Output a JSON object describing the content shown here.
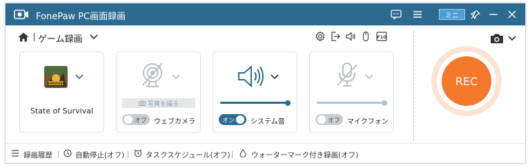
{
  "app": {
    "title": "FonePaw PC画面録画",
    "mini_label": "ミニ"
  },
  "toolbar": {
    "mode_label": "ゲーム録画"
  },
  "cards": {
    "game": {
      "label": "State of Survival"
    },
    "webcam": {
      "snapshot_label": "写真を撮る",
      "toggle_text": "オフ",
      "toggle_on": false,
      "label": "ウェブカメラ"
    },
    "system_sound": {
      "toggle_text": "オン",
      "toggle_on": true,
      "label": "システム音",
      "volume": 1.0
    },
    "microphone": {
      "toggle_text": "オフ",
      "toggle_on": false,
      "label": "マイクフォン",
      "volume": 1.0
    }
  },
  "rec": {
    "label": "REC"
  },
  "footer": {
    "history": "録画履歴",
    "auto_stop": "自動停止(オフ)",
    "schedule": "タスクスケジュール(オフ)",
    "watermark": "ウォーターマーク付き録画(オフ)"
  },
  "colors": {
    "titlebar": "#2c6a8f",
    "accent": "#2c6a8f",
    "rec": "#f4792b"
  }
}
